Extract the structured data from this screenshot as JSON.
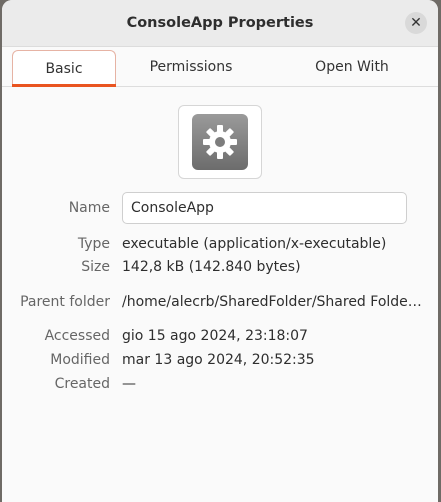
{
  "window": {
    "title": "ConsoleApp Properties",
    "close_label": "✕"
  },
  "tabs": [
    {
      "label": "Basic",
      "active": true
    },
    {
      "label": "Permissions",
      "active": false
    },
    {
      "label": "Open With",
      "active": false
    }
  ],
  "file": {
    "icon": "gear-icon",
    "name_label": "Name",
    "name_value": "ConsoleApp",
    "type_label": "Type",
    "type_value": "executable (application/x-executable)",
    "size_label": "Size",
    "size_value": "142,8 kB (142.840 bytes)",
    "parent_label": "Parent folder",
    "parent_value": "/home/alecrb/SharedFolder/Shared Folde…",
    "accessed_label": "Accessed",
    "accessed_value": "gio 15 ago 2024, 23:18:07",
    "modified_label": "Modified",
    "modified_value": "mar 13 ago 2024, 20:52:35",
    "created_label": "Created",
    "created_value": "—"
  },
  "colors": {
    "accent": "#e95420"
  }
}
